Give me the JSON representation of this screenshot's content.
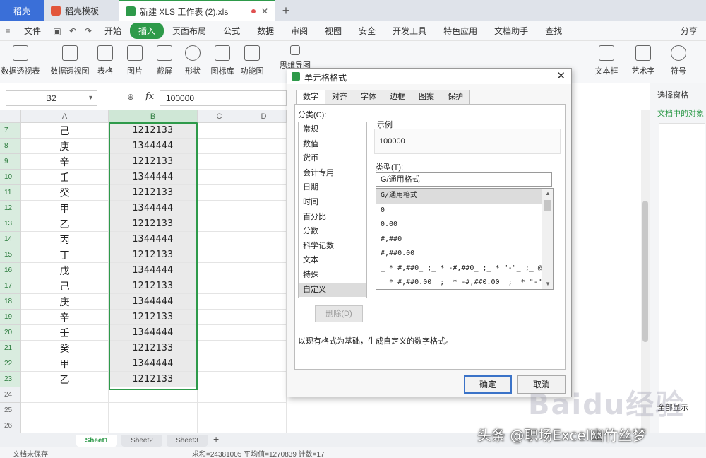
{
  "tabs": [
    {
      "label": "稻壳"
    },
    {
      "label": "稻壳模板"
    },
    {
      "label": "新建 XLS 工作表 (2).xls"
    }
  ],
  "menu": [
    "文件",
    "开始",
    "插入",
    "页面布局",
    "公式",
    "数据",
    "审阅",
    "视图",
    "安全",
    "开发工具",
    "特色应用",
    "文档助手",
    "查找"
  ],
  "menu_right": "分享",
  "ribbon": [
    "数据透视表",
    "数据透视图",
    "表格",
    "图片",
    "截屏",
    "形状",
    "图标库",
    "功能图",
    "思维导图",
    "文本框",
    "艺术字",
    "符号"
  ],
  "name_box": "B2",
  "formula_value": "100000",
  "columns": [
    "A",
    "B",
    "C",
    "D"
  ],
  "rows": [
    {
      "n": "7",
      "a": "己",
      "b": "1212133"
    },
    {
      "n": "8",
      "a": "庚",
      "b": "1344444"
    },
    {
      "n": "9",
      "a": "辛",
      "b": "1212133"
    },
    {
      "n": "10",
      "a": "壬",
      "b": "1344444"
    },
    {
      "n": "11",
      "a": "癸",
      "b": "1212133"
    },
    {
      "n": "12",
      "a": "甲",
      "b": "1344444"
    },
    {
      "n": "13",
      "a": "乙",
      "b": "1212133"
    },
    {
      "n": "14",
      "a": "丙",
      "b": "1344444"
    },
    {
      "n": "15",
      "a": "丁",
      "b": "1212133"
    },
    {
      "n": "16",
      "a": "戊",
      "b": "1344444"
    },
    {
      "n": "17",
      "a": "己",
      "b": "1212133"
    },
    {
      "n": "18",
      "a": "庚",
      "b": "1344444"
    },
    {
      "n": "19",
      "a": "辛",
      "b": "1212133"
    },
    {
      "n": "20",
      "a": "壬",
      "b": "1344444"
    },
    {
      "n": "21",
      "a": "癸",
      "b": "1212133"
    },
    {
      "n": "22",
      "a": "甲",
      "b": "1344444"
    },
    {
      "n": "23",
      "a": "乙",
      "b": "1212133"
    },
    {
      "n": "24",
      "a": "",
      "b": ""
    },
    {
      "n": "25",
      "a": "",
      "b": ""
    },
    {
      "n": "26",
      "a": "",
      "b": ""
    }
  ],
  "right_pane": {
    "title": "选择窗格",
    "subtitle": "文档中的对象",
    "footer": "全部显示"
  },
  "sheets": [
    "Sheet1",
    "Sheet2",
    "Sheet3"
  ],
  "status": {
    "left": "文档未保存",
    "sum": "求和=24381005 平均值=1270839 计数=17"
  },
  "dialog": {
    "title": "单元格格式",
    "tabs": [
      "数字",
      "对齐",
      "字体",
      "边框",
      "图案",
      "保护"
    ],
    "category_label": "分类(C):",
    "categories": [
      "常规",
      "数值",
      "货币",
      "会计专用",
      "日期",
      "时间",
      "百分比",
      "分数",
      "科学记数",
      "文本",
      "特殊",
      "自定义"
    ],
    "sample_label": "示例",
    "sample_value": "100000",
    "type_label": "类型(T):",
    "type_value": "G/通用格式",
    "types": [
      "G/通用格式",
      "0",
      "0.00",
      "#,##0",
      "#,##0.00",
      "_ * #,##0_ ;_ * -#,##0_ ;_ * \"-\"_ ;_ @_",
      "_ * #,##0.00_ ;_ * -#,##0.00_ ;_ * \"-\"??_ ;_ @_"
    ],
    "delete_label": "删除(D)",
    "description": "以现有格式为基础，生成自定义的数字格式。",
    "ok_label": "确定",
    "cancel_label": "取消"
  },
  "watermark": "头条 @职场Excel幽竹丝梦",
  "baidu_mark": "Baidu经验"
}
